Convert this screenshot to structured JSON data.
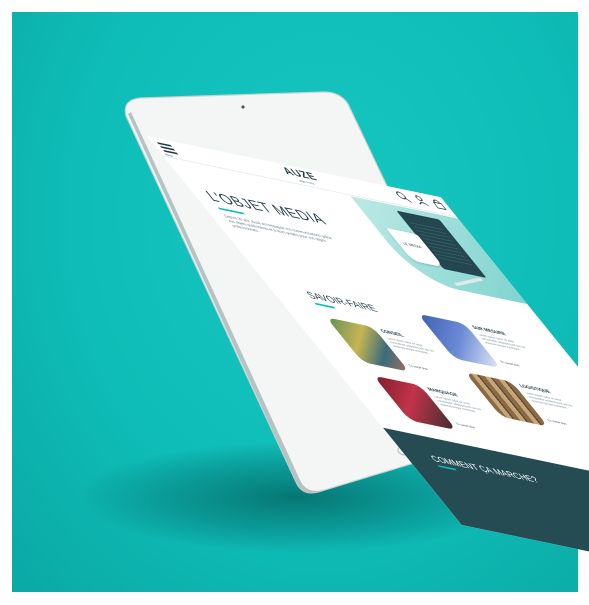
{
  "header": {
    "menu_label": "Menu",
    "logo": "AUZE",
    "logo_sub": "objet media",
    "icons": [
      "search-icon",
      "user-icon",
      "lock-icon"
    ]
  },
  "hero": {
    "title": "L'OBJET MEDIA",
    "description": "Depuis 20 ans, Auzé accompagne vos communications grâce aux objets publicitaires et à leurs projets pour vos objets professionnels.",
    "mug_text": "LE MEDIA"
  },
  "savoir_faire": {
    "title": "SAVOIR-FAIRE",
    "cards": [
      {
        "title": "CONSEIL",
        "text": "Lorem ipsum dolor sit amet consectetur adipiscing elit sed do eiusmod tempor incididunt.",
        "link": "En savoir plus"
      },
      {
        "title": "SUR MESURE",
        "text": "Lorem ipsum dolor sit amet consectetur adipiscing elit sed do eiusmod tempor incididunt.",
        "link": "En savoir plus"
      },
      {
        "title": "MARQUAGE",
        "text": "Lorem ipsum dolor sit amet consectetur adipiscing elit sed do eiusmod tempor incididunt.",
        "link": "En savoir plus"
      },
      {
        "title": "LOGISTIQUE",
        "text": "Lorem ipsum dolor sit amet consectetur adipiscing elit sed do eiusmod tempor incididunt.",
        "link": "En savoir plus"
      }
    ]
  },
  "how_it_works": {
    "title": "COMMENT ÇA MARCHE?"
  },
  "colors": {
    "backdrop": "#0fbdb8",
    "accent": "#13bab5",
    "dark": "#254b53"
  }
}
